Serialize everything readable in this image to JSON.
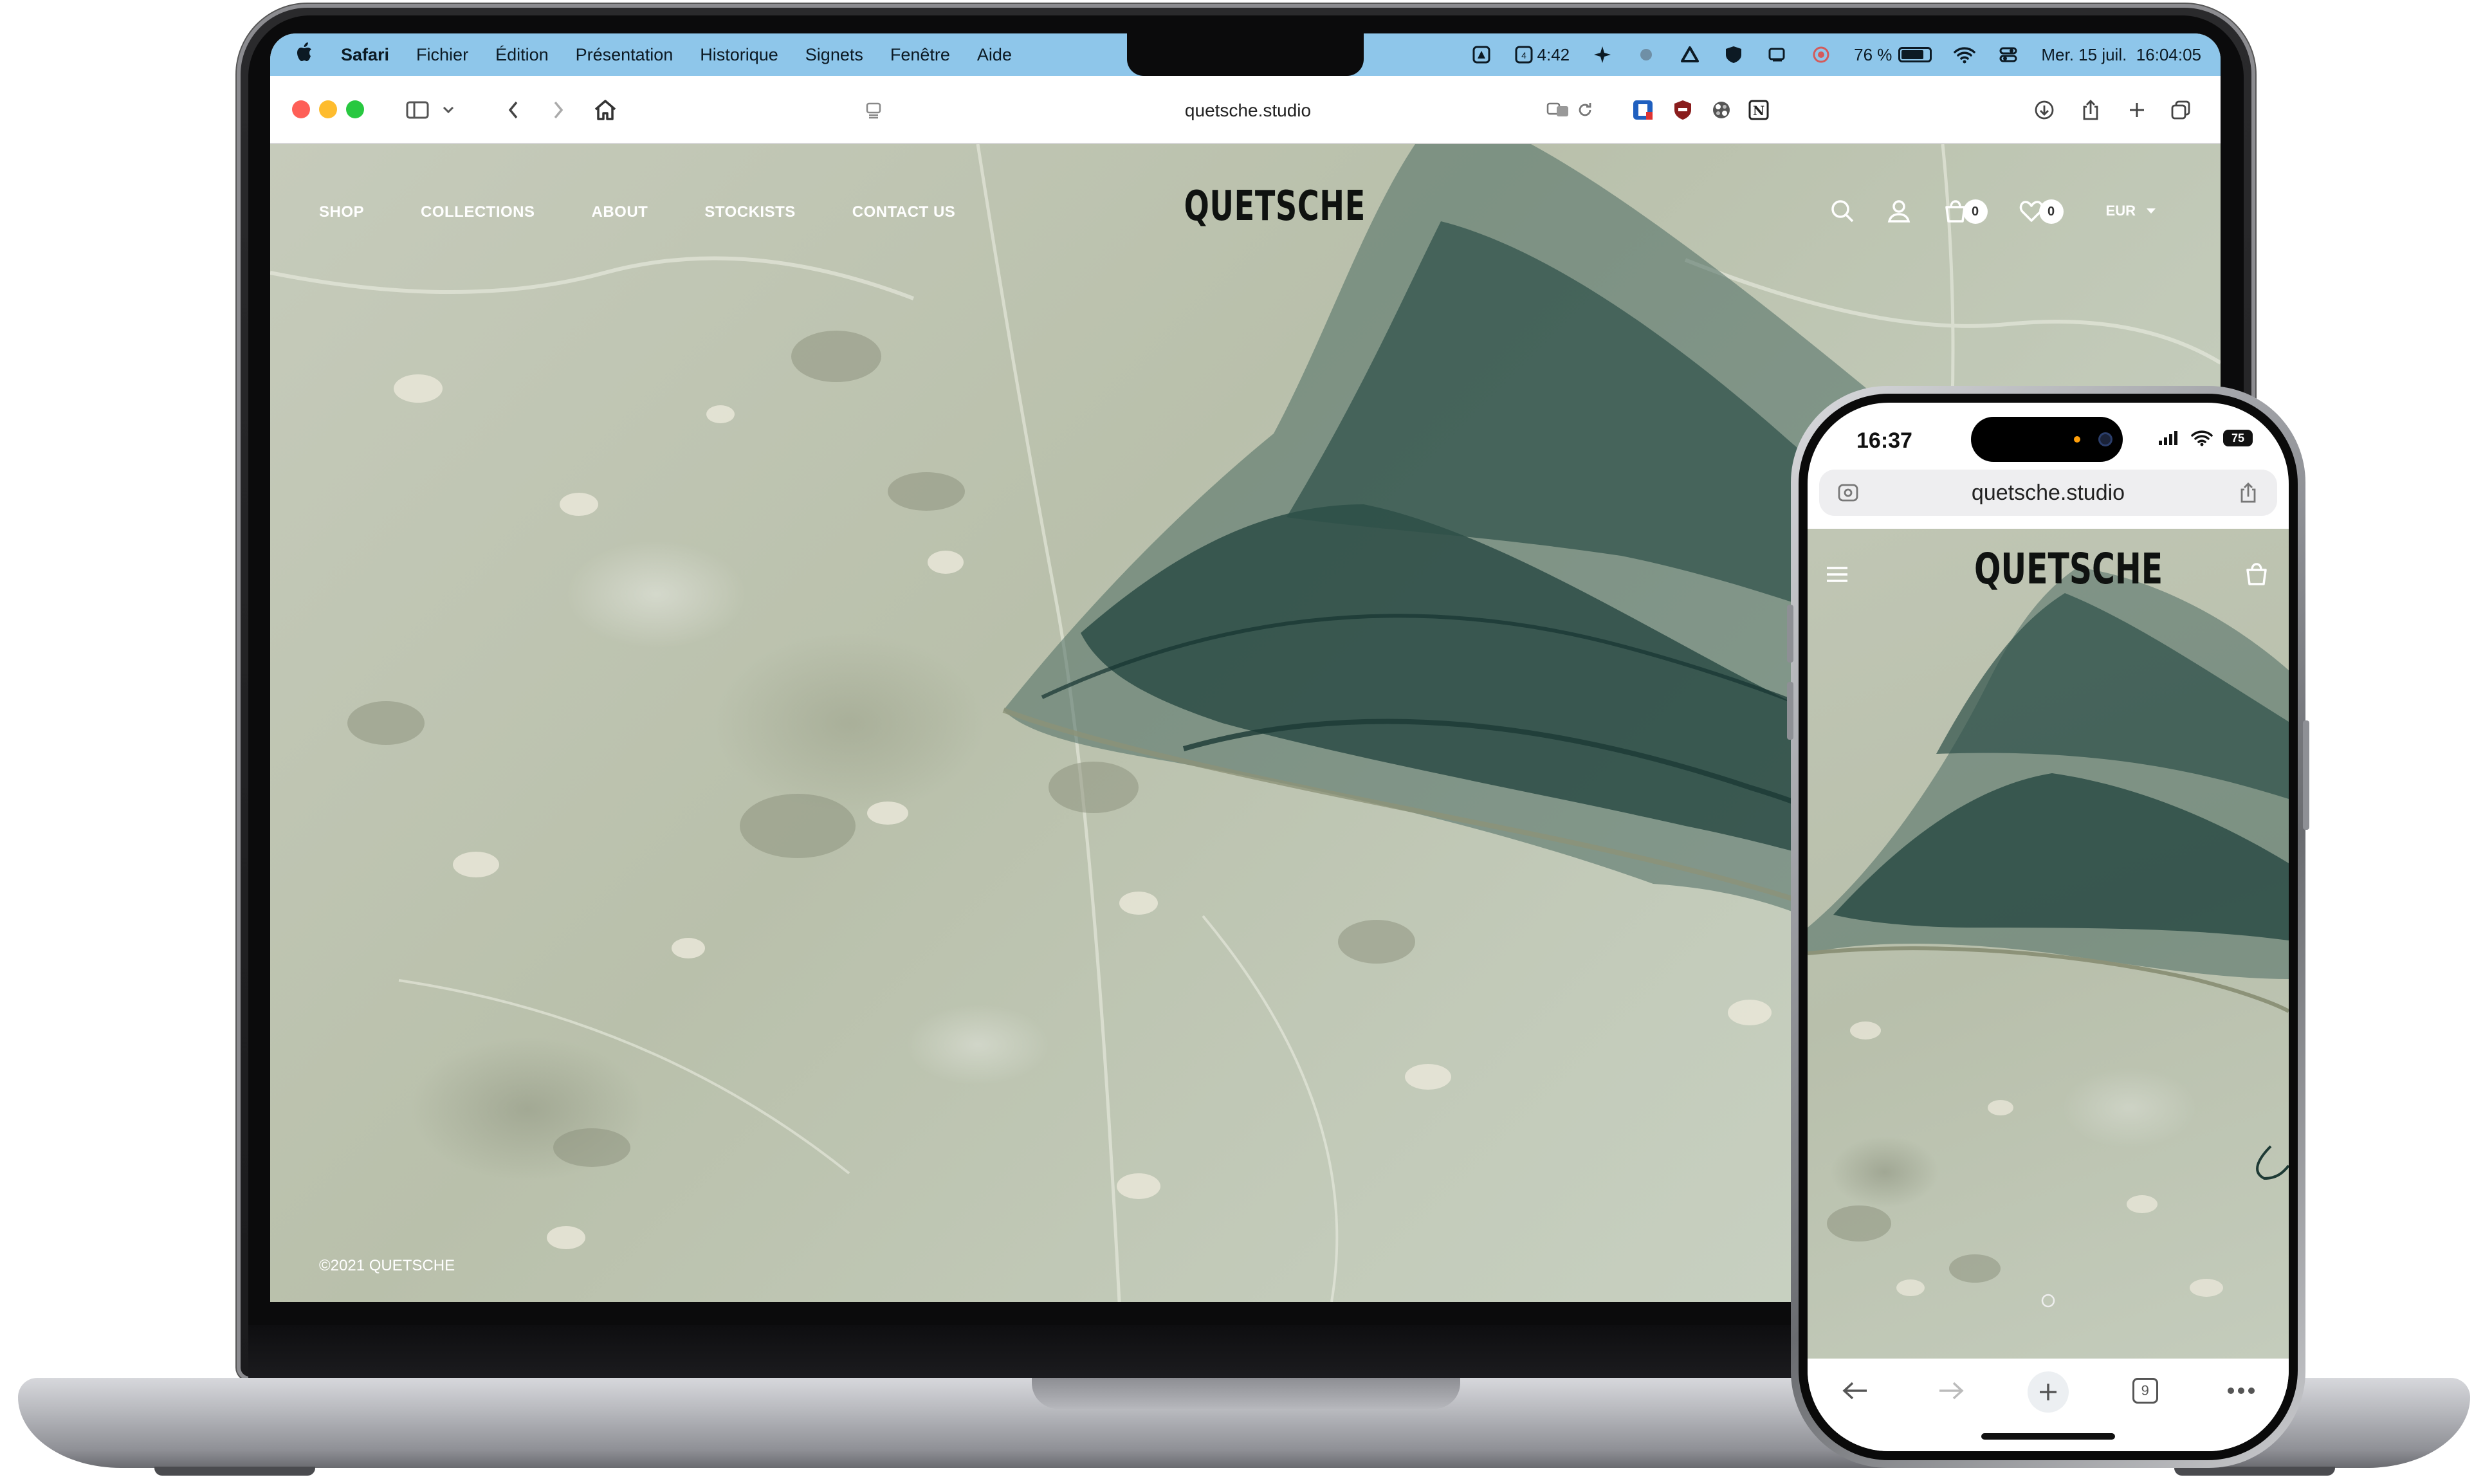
{
  "menubar": {
    "items": [
      "Safari",
      "Fichier",
      "Édition",
      "Présentation",
      "Historique",
      "Signets",
      "Fenêtre",
      "Aide"
    ],
    "timer": "4:42",
    "battery": "76 %",
    "datetime": "Mer. 15 juil.  16:04:05"
  },
  "browser": {
    "url": "quetsche.studio"
  },
  "site": {
    "nav": [
      "SHOP",
      "COLLECTIONS",
      "ABOUT",
      "STOCKISTS",
      "CONTACT US"
    ],
    "logo": "QUETSCHE",
    "cart_count": "0",
    "wishlist_count": "0",
    "currency": "EUR",
    "copyright": "©2021 QUETSCHE"
  },
  "phone": {
    "time": "16:37",
    "battery": "75",
    "url": "quetsche.studio",
    "logo": "QUETSCHE",
    "tabs_count": "9"
  },
  "colors": {
    "menubar_bg": "#8ec6ea",
    "fabric": "#234a45",
    "background_stone": "#c3cab7"
  }
}
